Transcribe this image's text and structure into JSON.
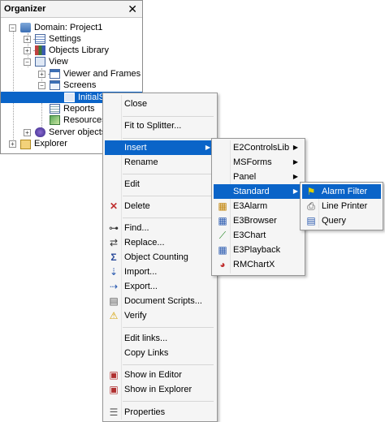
{
  "organizer": {
    "title": "Organizer",
    "close": "✕",
    "tree": [
      {
        "label": "Domain: Project1"
      },
      {
        "label": "Settings"
      },
      {
        "label": "Objects Library"
      },
      {
        "label": "View"
      },
      {
        "label": "Viewer and Frames"
      },
      {
        "label": "Screens"
      },
      {
        "label": "InitialS"
      },
      {
        "label": "Reports"
      },
      {
        "label": "Resources"
      },
      {
        "label": "Server objects"
      },
      {
        "label": "Explorer"
      }
    ]
  },
  "context_menu": {
    "items": [
      {
        "label": "Close",
        "icon": ""
      },
      {
        "label": "Fit to Splitter...",
        "icon": ""
      },
      {
        "label": "Insert",
        "icon": "",
        "submenu": true
      },
      {
        "label": "Rename",
        "icon": ""
      },
      {
        "label": "Edit",
        "icon": ""
      },
      {
        "label": "Delete",
        "icon": "delete-x-icon"
      },
      {
        "label": "Find...",
        "icon": "binoculars-icon"
      },
      {
        "label": "Replace...",
        "icon": "replace-icon"
      },
      {
        "label": "Object Counting",
        "icon": "sigma-icon"
      },
      {
        "label": "Import...",
        "icon": "import-icon"
      },
      {
        "label": "Export...",
        "icon": "export-icon"
      },
      {
        "label": "Document Scripts...",
        "icon": "scripts-icon"
      },
      {
        "label": "Verify",
        "icon": "warning-icon"
      },
      {
        "label": "Edit links...",
        "icon": ""
      },
      {
        "label": "Copy Links",
        "icon": ""
      },
      {
        "label": "Show in Editor",
        "icon": "show-editor-icon"
      },
      {
        "label": "Show in Explorer",
        "icon": "show-explorer-icon"
      },
      {
        "label": "Properties",
        "icon": "properties-icon"
      }
    ]
  },
  "insert_menu": {
    "items": [
      {
        "label": "E2ControlsLib",
        "submenu": true
      },
      {
        "label": "MSForms",
        "submenu": true
      },
      {
        "label": "Panel",
        "submenu": true
      },
      {
        "label": "Standard",
        "submenu": true
      },
      {
        "label": "E3Alarm",
        "icon": "e3alarm-icon"
      },
      {
        "label": "E3Browser",
        "icon": "e3browser-icon"
      },
      {
        "label": "E3Chart",
        "icon": "e3chart-icon"
      },
      {
        "label": "E3Playback",
        "icon": "e3playback-icon"
      },
      {
        "label": "RMChartX",
        "icon": "rmchart-icon"
      }
    ]
  },
  "standard_menu": {
    "items": [
      {
        "label": "Alarm Filter",
        "icon": "alarm-filter-icon"
      },
      {
        "label": "Line Printer",
        "icon": "printer-icon"
      },
      {
        "label": "Query",
        "icon": "query-icon"
      }
    ]
  },
  "colors": {
    "highlight": "#0a64c8",
    "menu_bg": "#f5f5f5"
  }
}
